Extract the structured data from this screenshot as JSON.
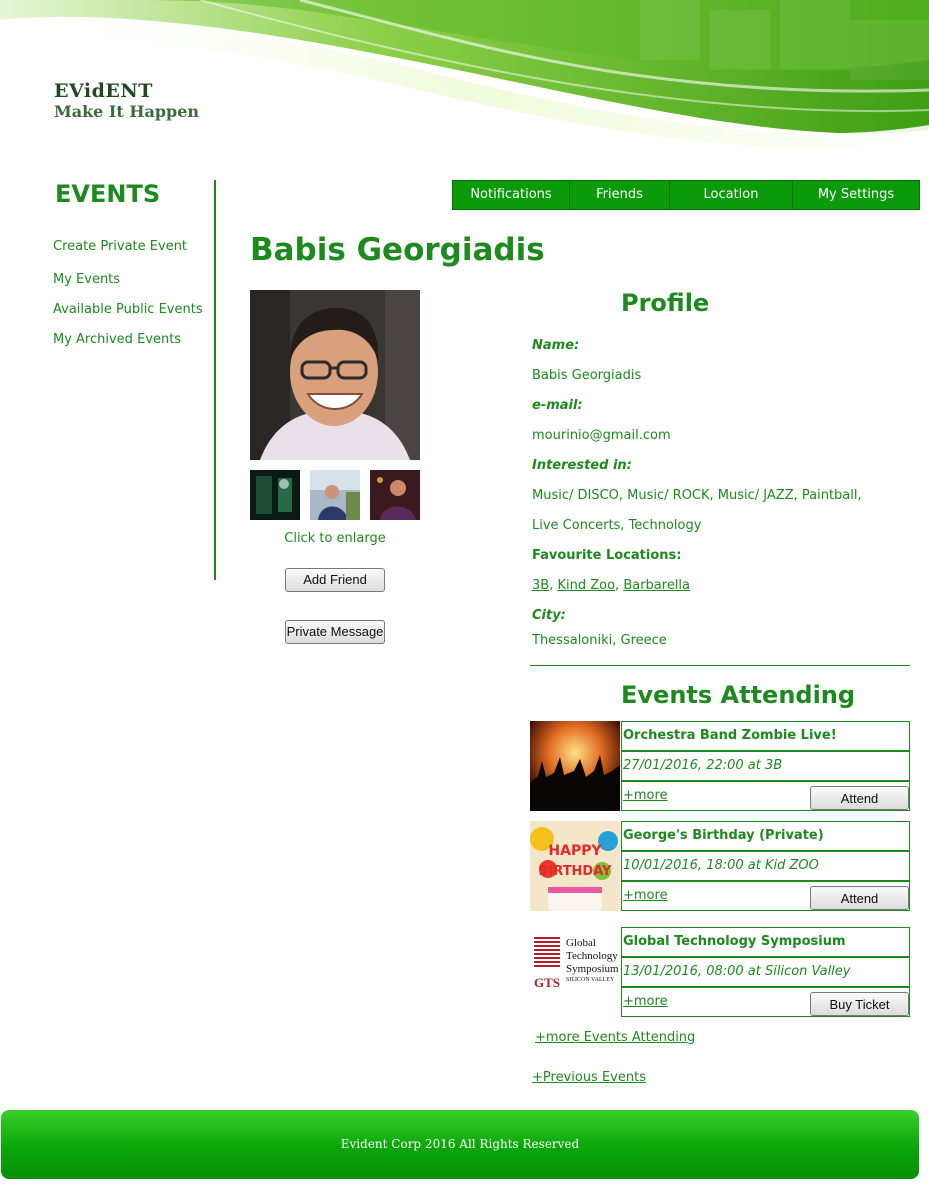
{
  "brand": {
    "name": "EVidENT",
    "tagline": "Make It Happen"
  },
  "nav": [
    "Notifications",
    "Friends",
    "Location",
    "My Settings"
  ],
  "sidebar": {
    "title": "EVENTS",
    "links": [
      "Create Private Event",
      "My Events",
      "Available Public Events",
      "My Archived Events"
    ]
  },
  "user": {
    "name": "Babis Georgiadis",
    "enlarge": "Click to enlarge",
    "add_friend": "Add Friend",
    "private_message": "Private Message"
  },
  "profile": {
    "title": "Profile",
    "name_label": "Name:",
    "name": "Babis Georgiadis",
    "email_label": "e-mail:",
    "email": "mourinio@gmail.com",
    "interests_label": "Interested in:",
    "interests_line1": "Music/ DISCO, Music/ ROCK, Music/ JAZZ, Paintball,",
    "interests_line2": "Live Concerts, Technology",
    "locations_label": "Favourite Locations:",
    "locations": [
      "3B",
      "Kind Zoo",
      "Barbarella"
    ],
    "city_label": "City:",
    "city": "Thessaloniki, Greece"
  },
  "events": {
    "title": "Events Attending",
    "items": [
      {
        "title": "Orchestra Band Zombie Live!",
        "date": "27/01/2016, 22:00 at 3B",
        "more": "+more",
        "action": "Attend"
      },
      {
        "title": "George's Birthday (Private)",
        "date": "10/01/2016, 18:00 at Kid ZOO",
        "more": "+more",
        "action": "Attend"
      },
      {
        "title": "Global Technology Symposium",
        "date": "13/01/2016, 08:00 at Silicon Valley",
        "more": "+more",
        "action": "Buy Ticket"
      }
    ],
    "more_link": "+more Events Attending",
    "previous_link": "+Previous Events"
  },
  "gts_logo": {
    "name_lines": [
      "Global",
      "Technology",
      "Symposium"
    ],
    "sub": "SILICON VALLEY",
    "mark": "GTS"
  },
  "footer": {
    "copyright": "Evident Corp  2016 All Rights Reserved"
  },
  "colors": {
    "primary": "#1c8a1c",
    "nav_bg": "#0a9a0a",
    "footer": "#0aa50a"
  }
}
